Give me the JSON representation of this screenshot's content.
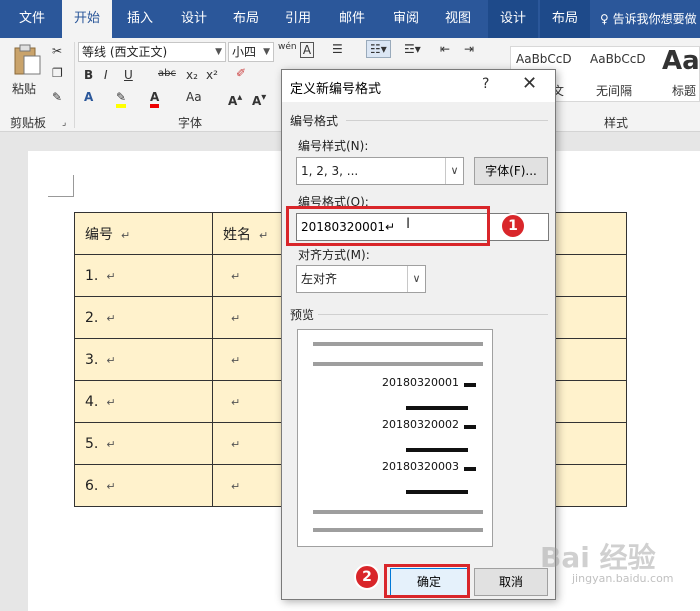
{
  "tabs": [
    "文件",
    "开始",
    "插入",
    "设计",
    "布局",
    "引用",
    "邮件",
    "审阅",
    "视图",
    "设计",
    "布局"
  ],
  "tell_me": "告诉我你想要做",
  "ribbon": {
    "paste": "粘贴",
    "clipboard_label": "剪贴板",
    "font_label": "字体",
    "style_label": "样式",
    "font_name": "等线 (西文正文)",
    "font_size": "小四",
    "wen": "wén",
    "char_box": "A",
    "bold": "B",
    "italic": "I",
    "underline": "U",
    "strike": "abc",
    "subscript": "x₂",
    "superscript": "x²",
    "styles": [
      {
        "preview": "AaBbCcD",
        "name": "正文"
      },
      {
        "preview": "AaBbCcD",
        "name": "无间隔"
      },
      {
        "preview": "AaB",
        "name": "标题"
      }
    ]
  },
  "table": {
    "headers": [
      "编号",
      "姓名"
    ],
    "rows": [
      "1.",
      "2.",
      "3.",
      "4.",
      "5.",
      "6."
    ],
    "mark": "↵"
  },
  "dialog": {
    "title": "定义新编号格式",
    "help": "?",
    "close": "✕",
    "group_label": "编号格式",
    "style_label": "编号样式(N):",
    "style_value": "1, 2, 3, ...",
    "font_button": "字体(F)...",
    "format_label": "编号格式(O):",
    "format_value": "20180320001↵",
    "align_label": "对齐方式(M):",
    "align_value": "左对齐",
    "preview_label": "预览",
    "preview_numbers": [
      "20180320001",
      "20180320002",
      "20180320003"
    ],
    "ok": "确定",
    "cancel": "取消"
  },
  "annotations": {
    "badge1": "1",
    "badge2": "2"
  },
  "watermark": "Bai 经验",
  "watermark_url": "jingyan.baidu.com"
}
